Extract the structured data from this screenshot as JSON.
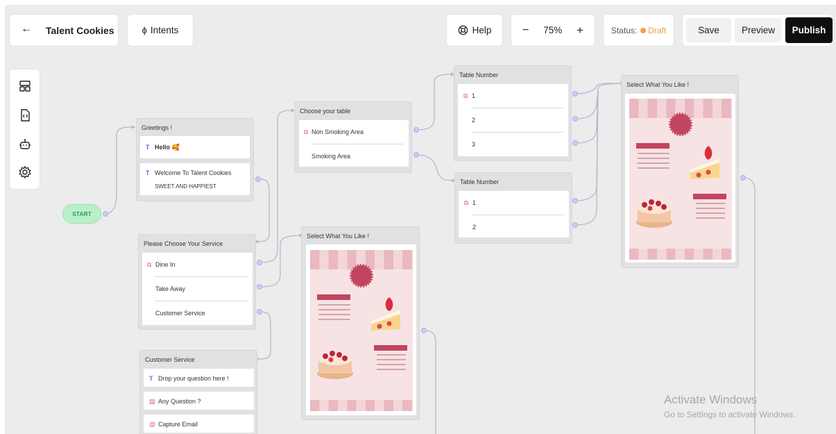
{
  "header": {
    "project_title": "Talent Cookies",
    "intents_label": "Intents",
    "help_label": "Help",
    "zoom_value": "75%",
    "zoom_minus": "−",
    "zoom_plus": "+",
    "status_label": "Status:",
    "status_value": "Draft",
    "save_label": "Save",
    "preview_label": "Preview",
    "publish_label": "Publish"
  },
  "sidebar": {
    "icons": [
      "layout-icon",
      "code-file-icon",
      "bot-icon",
      "settings-gear-icon"
    ]
  },
  "start": {
    "label": "START"
  },
  "nodes": {
    "greetings": {
      "title": "Greetings !",
      "hello": "Hello 🥰",
      "welcome": "Welcome To Talent Cookies",
      "tagline": "SWEET AND HAPPIEST"
    },
    "service": {
      "title": "Please Choose Your Service",
      "options": [
        "Dine In",
        "Take Away",
        "Customer Service"
      ]
    },
    "customer_service": {
      "title": "Customer Service",
      "drop_question": "Drop your question here !",
      "any_question": "Any Question ?",
      "capture_email": "Capture Email"
    },
    "choose_table": {
      "title": "Choose your table",
      "options": [
        "Non Smoking Area",
        "Smoking Area"
      ]
    },
    "select_like_1": {
      "title": "Select What You Like !"
    },
    "table_number_1": {
      "title": "Table Number",
      "options": [
        "1",
        "2",
        "3"
      ]
    },
    "table_number_2": {
      "title": "Table Number",
      "options": [
        "1",
        "2"
      ]
    },
    "select_like_2": {
      "title": "Select What You Like !"
    }
  },
  "watermark": {
    "line1": "Activate Windows",
    "line2": "Go to Settings to activate Windows."
  },
  "colors": {
    "status_draft": "#f0a24a",
    "publish_bg": "#0f0f0f",
    "start_bg": "#b9f0c9",
    "connector": "#b4b8cf",
    "port": "#c9cdf2"
  }
}
